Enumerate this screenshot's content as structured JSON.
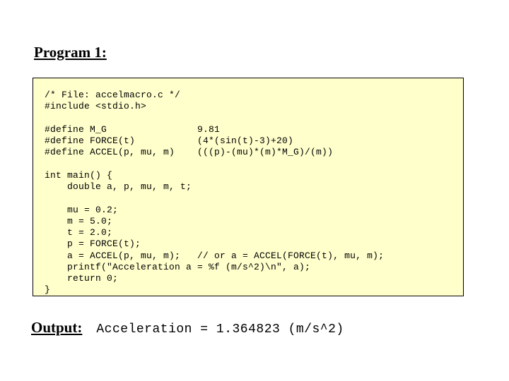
{
  "title": "Program 1:",
  "code": "/* File: accelmacro.c */\n#include <stdio.h>\n\n#define M_G                9.81\n#define FORCE(t)           (4*(sin(t)-3)+20)\n#define ACCEL(p, mu, m)    (((p)-(mu)*(m)*M_G)/(m))\n\nint main() {\n    double a, p, mu, m, t;\n\n    mu = 0.2;\n    m = 5.0;\n    t = 2.0;\n    p = FORCE(t);\n    a = ACCEL(p, mu, m);   // or a = ACCEL(FORCE(t), mu, m);\n    printf(\"Acceleration a = %f (m/s^2)\\n\", a);\n    return 0;\n}",
  "output_label": "Output:",
  "output_text": "Acceleration = 1.364823 (m/s^2)"
}
